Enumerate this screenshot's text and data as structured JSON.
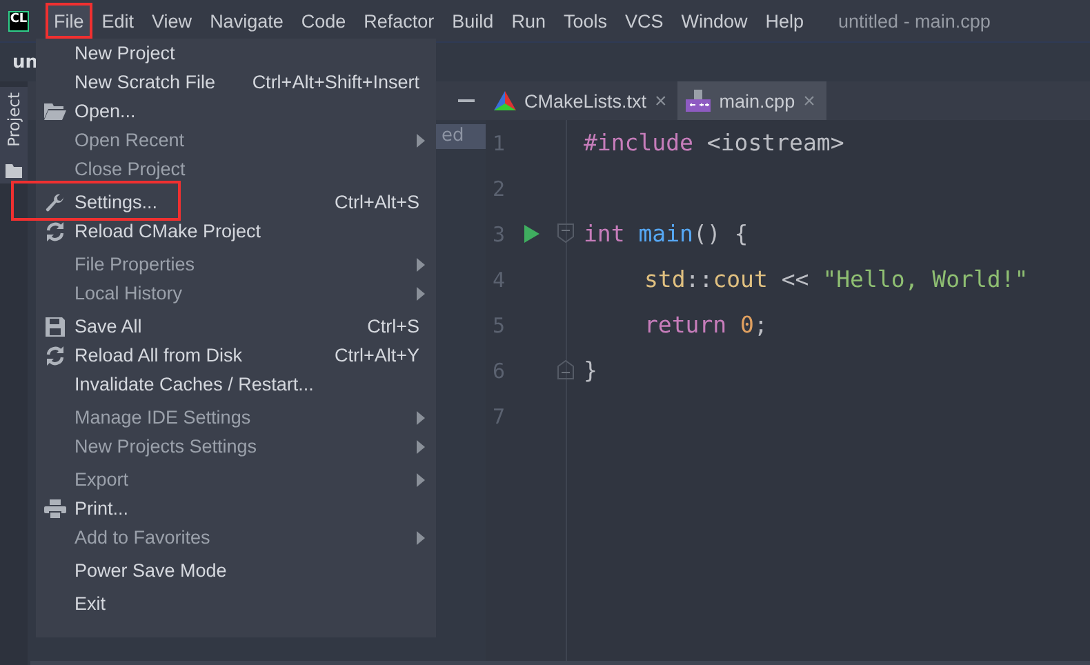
{
  "menu_bar": {
    "app_badge": "CL",
    "items": [
      {
        "label": "File",
        "selected": true,
        "highlighted": true
      },
      {
        "label": "Edit",
        "selected": false,
        "highlighted": false
      },
      {
        "label": "View",
        "selected": false,
        "highlighted": false
      },
      {
        "label": "Navigate",
        "selected": false,
        "highlighted": false
      },
      {
        "label": "Code",
        "selected": false,
        "highlighted": false
      },
      {
        "label": "Refactor",
        "selected": false,
        "highlighted": false
      },
      {
        "label": "Build",
        "selected": false,
        "highlighted": false
      },
      {
        "label": "Run",
        "selected": false,
        "highlighted": false
      },
      {
        "label": "Tools",
        "selected": false,
        "highlighted": false
      },
      {
        "label": "VCS",
        "selected": false,
        "highlighted": false
      },
      {
        "label": "Window",
        "selected": false,
        "highlighted": false
      },
      {
        "label": "Help",
        "selected": false,
        "highlighted": false
      }
    ],
    "window_title": "untitled - main.cpp"
  },
  "navigation_bar": {
    "project": "un"
  },
  "tool_strip": {
    "tab": "Project"
  },
  "project_panel": {
    "row": "ed"
  },
  "file_menu": [
    {
      "kind": "item",
      "label": "New Project",
      "dimmed": false
    },
    {
      "kind": "item",
      "label": "New Scratch File",
      "shortcut": "Ctrl+Alt+Shift+Insert",
      "dimmed": false
    },
    {
      "kind": "folder",
      "label": "Open...",
      "dimmed": false
    },
    {
      "kind": "item",
      "label": "Open Recent",
      "dimmed": true,
      "submenu": true
    },
    {
      "kind": "item",
      "label": "Close Project",
      "dimmed": true
    },
    {
      "kind": "separator"
    },
    {
      "kind": "wrench",
      "label": "Settings...",
      "shortcut": "Ctrl+Alt+S",
      "dimmed": false,
      "highlighted": true
    },
    {
      "kind": "sync",
      "label": "Reload CMake Project",
      "dimmed": false
    },
    {
      "kind": "separator"
    },
    {
      "kind": "item",
      "label": "File Properties",
      "dimmed": true,
      "submenu": true
    },
    {
      "kind": "item",
      "label": "Local History",
      "dimmed": true,
      "submenu": true
    },
    {
      "kind": "separator"
    },
    {
      "kind": "floppy",
      "label": "Save All",
      "shortcut": "Ctrl+S",
      "dimmed": false
    },
    {
      "kind": "sync",
      "label": "Reload All from Disk",
      "shortcut": "Ctrl+Alt+Y",
      "dimmed": false
    },
    {
      "kind": "item",
      "label": "Invalidate Caches / Restart...",
      "dimmed": false
    },
    {
      "kind": "separator"
    },
    {
      "kind": "item",
      "label": "Manage IDE Settings",
      "dimmed": true,
      "submenu": true
    },
    {
      "kind": "item",
      "label": "New Projects Settings",
      "dimmed": true,
      "submenu": true
    },
    {
      "kind": "separator"
    },
    {
      "kind": "item",
      "label": "Export",
      "dimmed": true,
      "submenu": true
    },
    {
      "kind": "printer",
      "label": "Print...",
      "dimmed": false
    },
    {
      "kind": "item",
      "label": "Add to Favorites",
      "dimmed": true,
      "submenu": true
    },
    {
      "kind": "separator"
    },
    {
      "kind": "item",
      "label": "Power Save Mode",
      "dimmed": false
    },
    {
      "kind": "separator"
    },
    {
      "kind": "item",
      "label": "Exit",
      "dimmed": false
    }
  ],
  "editor_tabs": [
    {
      "kind": "cmake",
      "label": "CMakeLists.txt",
      "selected": false,
      "close": "×"
    },
    {
      "kind": "cpp",
      "label": "main.cpp",
      "selected": true,
      "close": "×"
    }
  ],
  "code_lines": [
    {
      "number": "1",
      "tokens": [
        {
          "kind": "keyword",
          "text": "#include"
        },
        {
          "kind": "plain",
          "text": " <iostream>"
        }
      ]
    },
    {
      "number": "2"
    },
    {
      "number": "3",
      "run": true,
      "fold_start": true,
      "tokens": [
        {
          "kind": "keyword",
          "text": "int"
        },
        {
          "kind": "function",
          "text": " main"
        },
        {
          "kind": "plain",
          "text": "() {"
        }
      ]
    },
    {
      "number": "4",
      "indent": true,
      "tokens": [
        {
          "kind": "namespace",
          "text": "std"
        },
        {
          "kind": "plain",
          "text": "::"
        },
        {
          "kind": "namespace",
          "text": "cout"
        },
        {
          "kind": "plain",
          "text": " << "
        },
        {
          "kind": "string",
          "text": "\"Hello, World!\""
        }
      ]
    },
    {
      "number": "5",
      "indent": true,
      "tokens": [
        {
          "kind": "keyword",
          "text": "return"
        },
        {
          "kind": "number",
          "text": " 0"
        },
        {
          "kind": "plain",
          "text": ";"
        }
      ]
    },
    {
      "number": "6",
      "fold_end": true,
      "tokens": [
        {
          "kind": "plain",
          "text": "}"
        }
      ]
    },
    {
      "number": "7"
    }
  ]
}
